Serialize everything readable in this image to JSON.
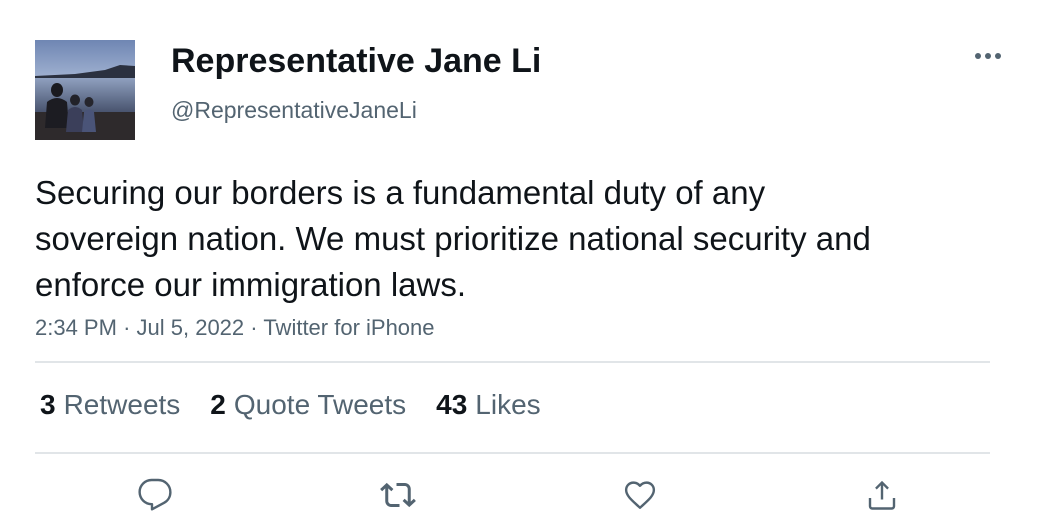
{
  "author": {
    "display_name": "Representative Jane Li",
    "handle": "@RepresentativeJaneLi"
  },
  "tweet": {
    "text": "Securing our borders is a fundamental duty of any sovereign nation. We must prioritize national security and enforce our immigration laws.",
    "time": "2:34 PM",
    "separator": "·",
    "date": "Jul 5, 2022",
    "source": "Twitter for iPhone"
  },
  "stats": {
    "retweets_count": "3",
    "retweets_label": "Retweets",
    "quotes_count": "2",
    "quotes_label": "Quote Tweets",
    "likes_count": "43",
    "likes_label": "Likes"
  },
  "icons": {
    "more": "more-horizontal-icon",
    "reply": "reply-icon",
    "retweet": "retweet-icon",
    "like": "heart-icon",
    "share": "share-icon"
  },
  "colors": {
    "text_primary": "#0f1419",
    "text_secondary": "#536471",
    "icon": "#536471",
    "divider": "#e1e5e8"
  }
}
